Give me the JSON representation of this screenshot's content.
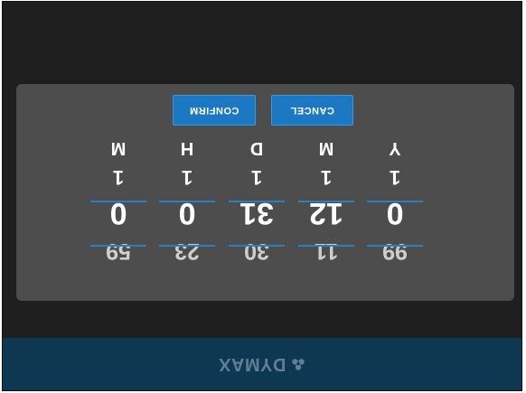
{
  "brand": {
    "logo_text": "DYMAX",
    "logo_icon": "dymax-logo-icon"
  },
  "colors": {
    "header_bar": "#0e3852",
    "panel": "#4d4d4d",
    "accent": "#1c78c2",
    "background": "#1f1f1f"
  },
  "picker": {
    "columns": [
      {
        "id": "year",
        "unit": "Y",
        "previous": "99",
        "value": "0",
        "next": "1"
      },
      {
        "id": "month",
        "unit": "M",
        "previous": "11",
        "value": "12",
        "next": "1"
      },
      {
        "id": "day",
        "unit": "D",
        "previous": "30",
        "value": "31",
        "next": "1"
      },
      {
        "id": "hour",
        "unit": "H",
        "previous": "23",
        "value": "0",
        "next": "1"
      },
      {
        "id": "minute",
        "unit": "M",
        "previous": "59",
        "value": "0",
        "next": "1"
      }
    ]
  },
  "actions": {
    "cancel_label": "CANCEL",
    "confirm_label": "CONFIRM"
  }
}
